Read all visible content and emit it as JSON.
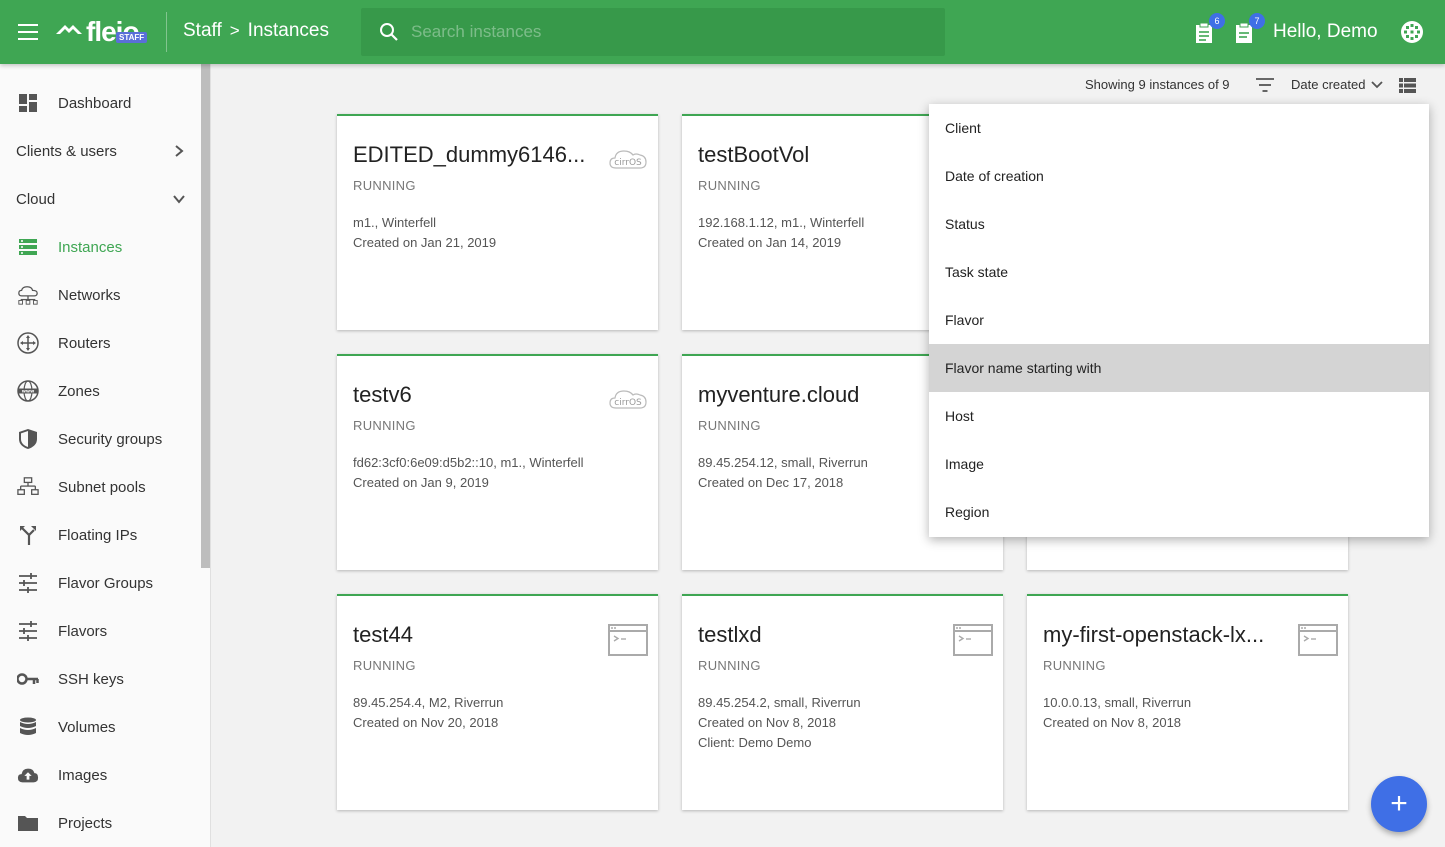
{
  "header": {
    "logo_text": "fleio",
    "logo_badge": "STAFF",
    "breadcrumb": [
      "Staff",
      "Instances"
    ],
    "breadcrumb_sep": ">",
    "search_placeholder": "Search instances",
    "notifications": [
      {
        "count": "6"
      },
      {
        "count": "7"
      }
    ],
    "greeting": "Hello, Demo"
  },
  "sidebar": {
    "items": [
      {
        "label": "Dashboard",
        "icon": "dashboard-icon"
      },
      {
        "label": "Clients & users",
        "icon": "none",
        "chevron": "›"
      },
      {
        "label": "Cloud",
        "icon": "none",
        "chevron": "⌄"
      },
      {
        "label": "Instances",
        "icon": "instances-icon",
        "active": true
      },
      {
        "label": "Networks",
        "icon": "cloud-network-icon"
      },
      {
        "label": "Routers",
        "icon": "router-icon"
      },
      {
        "label": "Zones",
        "icon": "www-globe-icon"
      },
      {
        "label": "Security groups",
        "icon": "shield-icon"
      },
      {
        "label": "Subnet pools",
        "icon": "sitemap-icon"
      },
      {
        "label": "Floating IPs",
        "icon": "fork-icon"
      },
      {
        "label": "Flavor Groups",
        "icon": "tune-icon"
      },
      {
        "label": "Flavors",
        "icon": "tune-icon"
      },
      {
        "label": "SSH keys",
        "icon": "key-icon"
      },
      {
        "label": "Volumes",
        "icon": "database-icon"
      },
      {
        "label": "Images",
        "icon": "cloud-upload-icon"
      },
      {
        "label": "Projects",
        "icon": "folder-icon"
      }
    ]
  },
  "toolbar": {
    "showing": "Showing 9 instances of 9",
    "sort_label": "Date created"
  },
  "cards": [
    {
      "name": "EDITED_dummy6146...",
      "status": "RUNNING",
      "line1": "m1., Winterfell",
      "line2": "Created on Jan 21, 2019",
      "line3": "",
      "image": "cirros"
    },
    {
      "name": "testBootVol",
      "status": "RUNNING",
      "line1": "192.168.1.12, m1., Winterfell",
      "line2": "Created on Jan 14, 2019",
      "line3": "",
      "image": "none"
    },
    {
      "name": "",
      "status": "",
      "line1": "",
      "line2": "",
      "line3": "",
      "image": "none"
    },
    {
      "name": "testv6",
      "status": "RUNNING",
      "line1": "fd62:3cf0:6e09:d5b2::10, m1., Winterfell",
      "line2": "Created on Jan 9, 2019",
      "line3": "",
      "image": "cirros"
    },
    {
      "name": "myventure.cloud",
      "status": "RUNNING",
      "line1": "89.45.254.12, small, Riverrun",
      "line2": "Created on Dec 17, 2018",
      "line3": "",
      "image": "none"
    },
    {
      "name": "",
      "status": "",
      "line1": "",
      "line2": "",
      "line3": "",
      "image": "none"
    },
    {
      "name": "test44",
      "status": "RUNNING",
      "line1": "89.45.254.4, M2, Riverrun",
      "line2": "Created on Nov 20, 2018",
      "line3": "",
      "image": "terminal"
    },
    {
      "name": "testlxd",
      "status": "RUNNING",
      "line1": "89.45.254.2, small, Riverrun",
      "line2": "Created on Nov 8, 2018",
      "line3": "Client: Demo Demo",
      "image": "terminal"
    },
    {
      "name": "my-first-openstack-lx...",
      "status": "RUNNING",
      "line1": "10.0.0.13, small, Riverrun",
      "line2": "Created on Nov 8, 2018",
      "line3": "",
      "image": "terminal"
    }
  ],
  "filter_menu": {
    "items": [
      "Client",
      "Date of creation",
      "Status",
      "Task state",
      "Flavor",
      "Flavor name starting with",
      "Host",
      "Image",
      "Region"
    ],
    "highlighted": "Flavor name starting with"
  },
  "fab_label": "+",
  "colors": {
    "primary": "#3fa653",
    "accent": "#3f6fe6"
  }
}
